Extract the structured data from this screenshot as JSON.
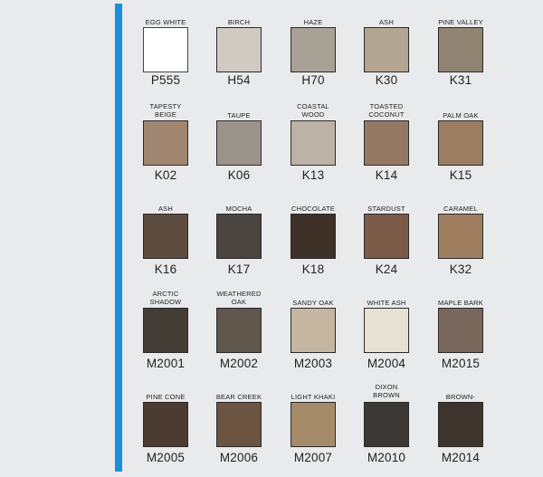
{
  "colors": {
    "accent": "#1a8fd8",
    "background": "#e9eaec"
  },
  "rows": [
    [
      {
        "name": "EGG WHITE",
        "code": "P555",
        "color": "#ffffff"
      },
      {
        "name": "BIRCH",
        "code": "H54",
        "color": "#cfcac2"
      },
      {
        "name": "HAZE",
        "code": "H70",
        "color": "#a8a195"
      },
      {
        "name": "ASH",
        "code": "K30",
        "color": "#b2a692"
      },
      {
        "name": "PINE VALLEY",
        "code": "K31",
        "color": "#8f8371"
      }
    ],
    [
      {
        "name": "TAPESTY BEIGE",
        "code": "K02",
        "color": "#a08670"
      },
      {
        "name": "TAUPE",
        "code": "K06",
        "color": "#9a9389"
      },
      {
        "name": "COASTAL WOOD",
        "code": "K13",
        "color": "#bcb2a5"
      },
      {
        "name": "TOASTED COCONUT",
        "code": "K14",
        "color": "#957965"
      },
      {
        "name": "PALM OAK",
        "code": "K15",
        "color": "#9b7d61"
      }
    ],
    [
      {
        "name": "ASH",
        "code": "K16",
        "color": "#5e4c3f"
      },
      {
        "name": "MOCHA",
        "code": "K17",
        "color": "#4a4540"
      },
      {
        "name": "CHOCOLATE",
        "code": "K18",
        "color": "#3d3128"
      },
      {
        "name": "STARDUST",
        "code": "K24",
        "color": "#7b5b48"
      },
      {
        "name": "CARAMEL",
        "code": "K32",
        "color": "#9e7e5f"
      }
    ],
    [
      {
        "name": "ARCTIC SHADOW",
        "code": "M2001",
        "color": "#443d36"
      },
      {
        "name": "WEATHERED OAK",
        "code": "M2002",
        "color": "#5f574c"
      },
      {
        "name": "SANDY OAK",
        "code": "M2003",
        "color": "#c4b6a1"
      },
      {
        "name": "WHITE ASH",
        "code": "M2004",
        "color": "#e6e1d2"
      },
      {
        "name": "MAPLE BARK",
        "code": "M2015",
        "color": "#7a675c"
      }
    ],
    [
      {
        "name": "PINE CONE",
        "code": "M2005",
        "color": "#4b3b30"
      },
      {
        "name": "BEAR  CREEK",
        "code": "M2006",
        "color": "#6c5443"
      },
      {
        "name": "LIGHT KHAKI",
        "code": "M2007",
        "color": "#a68b6b"
      },
      {
        "name": "DIXON BROWN",
        "code": "M2010",
        "color": "#3b3835"
      },
      {
        "name": "BROWN-STONE",
        "code": "M2014",
        "color": "#3d342d"
      }
    ]
  ]
}
